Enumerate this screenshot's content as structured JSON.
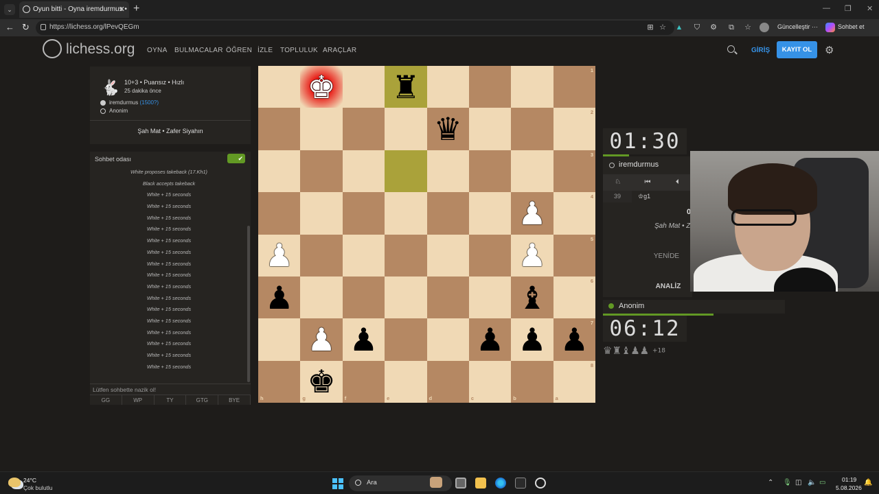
{
  "browser": {
    "tab_title": "Oyun bitti - Oyna iremdurmus • lic",
    "url": "https://lichess.org/lPevQEGm",
    "update_label": "Güncelleştir ···",
    "chat_label": "Sohbet et"
  },
  "site": {
    "logo_text": "lichess.org",
    "nav": [
      "OYNA",
      "BULMACALAR",
      "ÖĞREN",
      "İZLE",
      "TOPLULUK",
      "ARAÇLAR"
    ],
    "login": "GİRİŞ",
    "signup": "KAYIT OL"
  },
  "game": {
    "mode": "10+3 • Puansız • Hızlı",
    "ago": "25 dakika önce",
    "white_player": "iremdurmus",
    "white_rating": "(1500?)",
    "black_player": "Anonim",
    "result": "Şah Mat • Zafer Siyahın"
  },
  "chat": {
    "title": "Sohbet odası",
    "messages": [
      "White proposes takeback (17.Kh1)",
      "Black accepts takeback",
      "White + 15 seconds",
      "White + 15 seconds",
      "White + 15 seconds",
      "White + 15 seconds",
      "White + 15 seconds",
      "White + 15 seconds",
      "White + 15 seconds",
      "White + 15 seconds",
      "White + 15 seconds",
      "White + 15 seconds",
      "White + 15 seconds",
      "White + 15 seconds",
      "White + 15 seconds",
      "White + 15 seconds",
      "White + 15 seconds",
      "White + 15 seconds"
    ],
    "input_placeholder": "Lütfen sohbette nazik ol!",
    "presets": [
      "GG",
      "WP",
      "TY",
      "GTG",
      "BYE"
    ]
  },
  "board": {
    "orientation": "black",
    "rank_labels": [
      "1",
      "2",
      "3",
      "4",
      "5",
      "6",
      "7",
      "8"
    ],
    "file_labels": [
      "h",
      "g",
      "f",
      "e",
      "d",
      "c",
      "b",
      "a"
    ],
    "pieces": [
      {
        "square": "g1",
        "piece": "king",
        "color": "white",
        "glyph": "♚",
        "in_check": true
      },
      {
        "square": "e1",
        "piece": "rook",
        "color": "black",
        "glyph": "♜"
      },
      {
        "square": "d2",
        "piece": "queen",
        "color": "black",
        "glyph": "♛"
      },
      {
        "square": "b4",
        "piece": "pawn",
        "color": "white",
        "glyph": "♟"
      },
      {
        "square": "h5",
        "piece": "pawn",
        "color": "white",
        "glyph": "♟"
      },
      {
        "square": "b5",
        "piece": "pawn",
        "color": "white",
        "glyph": "♟"
      },
      {
        "square": "h6",
        "piece": "pawn",
        "color": "black",
        "glyph": "♟"
      },
      {
        "square": "b6",
        "piece": "bishop",
        "color": "black",
        "glyph": "♝"
      },
      {
        "square": "g7",
        "piece": "pawn",
        "color": "white",
        "glyph": "♟"
      },
      {
        "square": "f7",
        "piece": "pawn",
        "color": "black",
        "glyph": "♟"
      },
      {
        "square": "c7",
        "piece": "pawn",
        "color": "black",
        "glyph": "♟"
      },
      {
        "square": "b7",
        "piece": "pawn",
        "color": "black",
        "glyph": "♟"
      },
      {
        "square": "a7",
        "piece": "pawn",
        "color": "black",
        "glyph": "♟"
      },
      {
        "square": "g8",
        "piece": "king",
        "color": "black",
        "glyph": "♚"
      }
    ],
    "highlighted": [
      "e1",
      "e3"
    ],
    "light_color": "#f0d9b5",
    "dark_color": "#b58863",
    "highlight_color": "#aaa23a"
  },
  "right_panel": {
    "top_clock": "01:30",
    "top_player": "iremdurmus",
    "move_number": "39",
    "move": "♔g1",
    "score": "0",
    "result_short": "Şah Mat • Z",
    "rematch": "YENİDE",
    "analysis": "ANALİZ",
    "bottom_player": "Anonim",
    "bottom_clock": "06:12",
    "material_diff": "+18",
    "captured_glyphs": "♛♜♝♟♟"
  },
  "taskbar": {
    "temp": "24°C",
    "weather": "Çok bulutlu",
    "search": "Ara",
    "time": "01:19",
    "date": "5.08.2026"
  }
}
